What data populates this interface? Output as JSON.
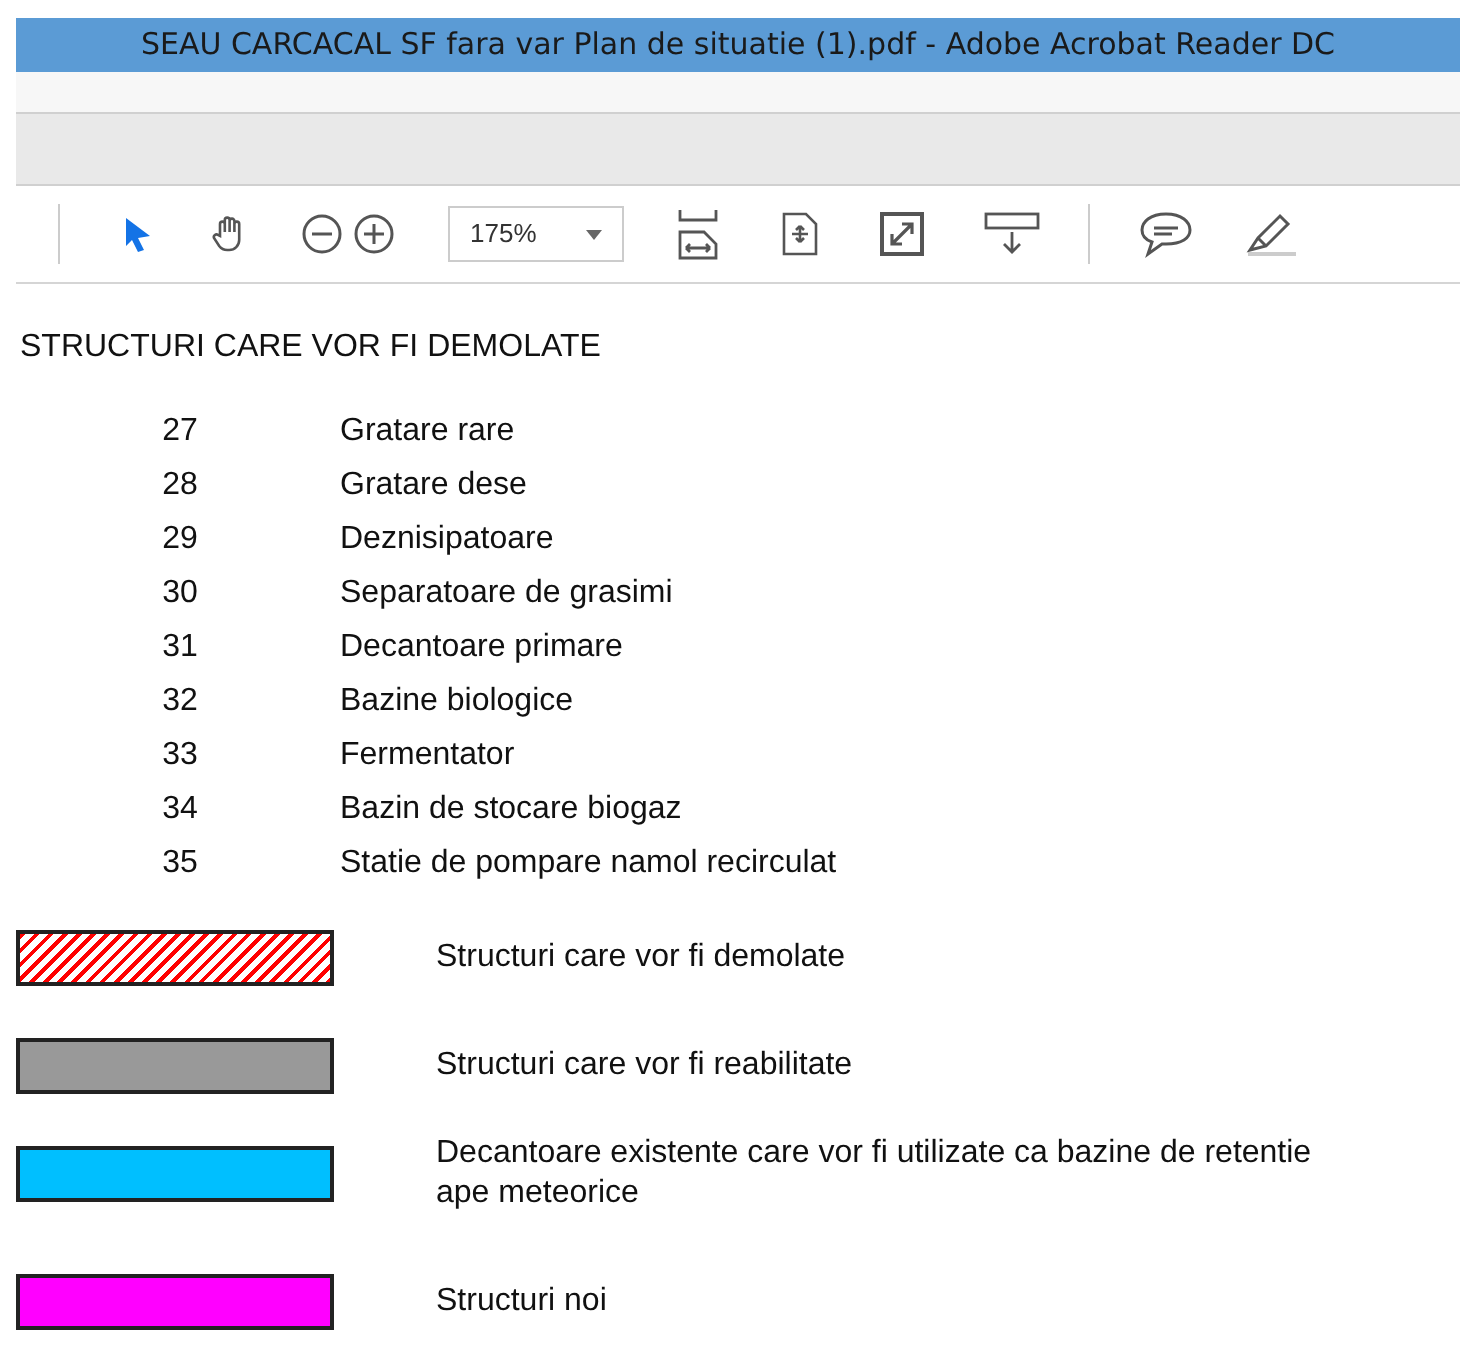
{
  "window": {
    "title": "SEAU CARCACAL SF fara var Plan de situatie (1).pdf - Adobe Acrobat Reader DC"
  },
  "toolbar": {
    "zoom": "175%",
    "tools": [
      {
        "kind": "select",
        "selected": true
      },
      {
        "kind": "hand",
        "selected": false
      },
      {
        "kind": "zoom-out",
        "selected": false
      },
      {
        "kind": "zoom-in",
        "selected": false
      }
    ]
  },
  "document": {
    "heading": "STRUCTURI CARE VOR FI DEMOLATE",
    "items": [
      {
        "number": "27",
        "label": "Gratare rare"
      },
      {
        "number": "28",
        "label": "Gratare dese"
      },
      {
        "number": "29",
        "label": "Deznisipatoare"
      },
      {
        "number": "30",
        "label": "Separatoare de grasimi"
      },
      {
        "number": "31",
        "label": "Decantoare primare"
      },
      {
        "number": "32",
        "label": "Bazine biologice"
      },
      {
        "number": "33",
        "label": "Fermentator"
      },
      {
        "number": "34",
        "label": "Bazin de stocare biogaz"
      },
      {
        "number": "35",
        "label": "Statie de pompare namol recirculat"
      }
    ],
    "legend": [
      {
        "kind": "hatched",
        "color": "#ff0000",
        "label": "Structuri care vor fi demolate"
      },
      {
        "kind": "solid",
        "color": "#999999",
        "label": "Structuri care vor fi reabilitate"
      },
      {
        "kind": "solid",
        "color": "#00bfff",
        "label": "Decantoare existente care vor fi utilizate ca bazine de retentie ape meteorice"
      },
      {
        "kind": "solid",
        "color": "#ff00ff",
        "label": "Structuri noi"
      }
    ]
  }
}
